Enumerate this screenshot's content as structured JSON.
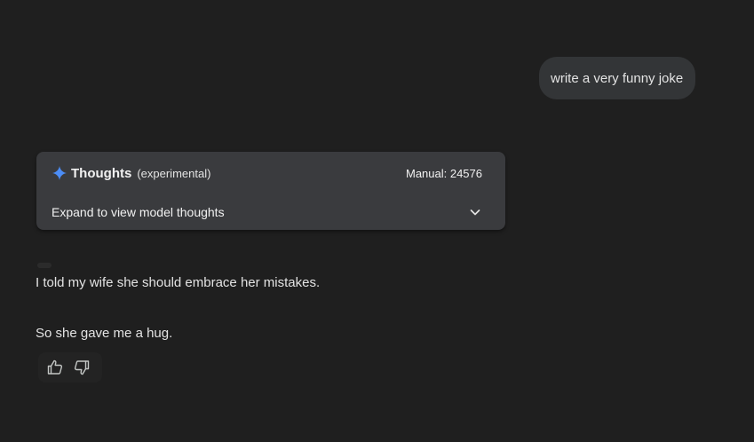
{
  "user_message": {
    "text": "write a very funny joke"
  },
  "thoughts_panel": {
    "icon": "sparkle-icon",
    "title": "Thoughts",
    "subtitle": "(experimental)",
    "manual_label": "Manual: 24576",
    "expand_label": "Expand to view model thoughts",
    "expand_icon": "chevron-down-icon",
    "accent_color": "#4c8df6"
  },
  "response": {
    "lines": [
      "I told my wife she should embrace her mistakes.",
      "So she gave me a hug."
    ]
  },
  "feedback": {
    "like_icon": "thumbs-up-icon",
    "dislike_icon": "thumbs-down-icon"
  }
}
